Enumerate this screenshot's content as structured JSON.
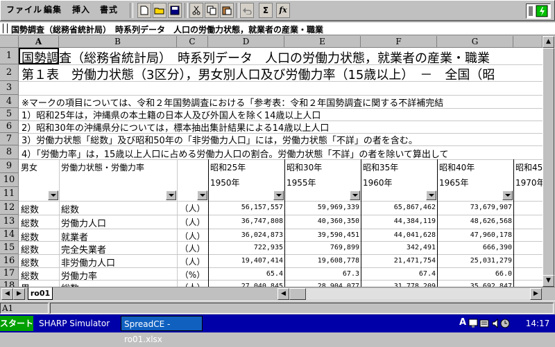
{
  "menu": [
    "ファイル",
    "編集",
    "挿入",
    "書式"
  ],
  "toolbar_icons": [
    "new-file-icon",
    "open-folder-icon",
    "save-icon",
    "cut-icon",
    "copy-icon",
    "paste-icon",
    "undo-icon",
    "sum-icon",
    "function-icon"
  ],
  "toolbar_glyphs": {
    "sum": "Σ",
    "function": "fx"
  },
  "formula_bar": {
    "content": "国勢調査（総務省統計局）　時系列データ　人口の労働力状態，就業者の産業・職業"
  },
  "columns": [
    "A",
    "B",
    "C",
    "D",
    "E",
    "F",
    "G"
  ],
  "rows": [
    "1",
    "2",
    "3",
    "4",
    "5",
    "6",
    "7",
    "8",
    "9",
    "10",
    "11",
    "12",
    "13",
    "14",
    "15",
    "16",
    "17",
    "18"
  ],
  "text_rows": {
    "r1": "国勢調査（総務省統計局）　時系列データ　人口の労働力状態，就業者の産業・職業",
    "r2": "第１表　労働力状態（3区分），男女別人口及び労働力率（15歳以上）　－　全国（昭",
    "r4": "※マークの項目については、令和２年国勢調査における「参考表：令和２年国勢調査に関する不詳補完結",
    "r5": "1）昭和25年は，沖縄県の本土籍の日本人及び外国人を除く14歳以上人口",
    "r6": "2）昭和30年の沖縄県分については，標本抽出集計結果による14歳以上人口",
    "r7": "3）労働力状態「総数」及び昭和50年の「非労働力人口」には，労働力状態「不詳」の者を含む。",
    "r8": "4）「労働力率」は，15歳以上人口に占める労働力人口の割合。労働力状態「不詳」の者を除いて算出して"
  },
  "header": {
    "a9": "男女",
    "b9": "労働力状態・労働力率",
    "years": [
      "昭和25年",
      "昭和30年",
      "昭和35年",
      "昭和40年",
      "昭和45"
    ],
    "western": [
      "1950年",
      "1955年",
      "1960年",
      "1965年",
      "1970年"
    ]
  },
  "data_rows": [
    {
      "a": "総数",
      "b": "総数",
      "c": "（人）",
      "v": [
        "56,157,557",
        "59,969,339",
        "65,867,462",
        "73,679,907"
      ]
    },
    {
      "a": "総数",
      "b": "労働力人口",
      "c": "（人）",
      "v": [
        "36,747,808",
        "40,360,350",
        "44,384,119",
        "48,626,568"
      ]
    },
    {
      "a": "総数",
      "b": "就業者",
      "c": "（人）",
      "v": [
        "36,024,873",
        "39,590,451",
        "44,041,628",
        "47,960,178"
      ]
    },
    {
      "a": "総数",
      "b": "完全失業者",
      "c": "（人）",
      "v": [
        "722,935",
        "769,899",
        "342,491",
        "666,390"
      ]
    },
    {
      "a": "総数",
      "b": "非労働力人口",
      "c": "（人）",
      "v": [
        "19,407,414",
        "19,608,778",
        "21,471,754",
        "25,031,279"
      ]
    },
    {
      "a": "総数",
      "b": "労働力率",
      "c": "（%）",
      "v": [
        "65.4",
        "67.3",
        "67.4",
        "66.0"
      ]
    },
    {
      "a": "男",
      "b": "総数",
      "c": "（人）",
      "v": [
        "27,040,845",
        "28,904,077",
        "31,778,209",
        "35,692,847"
      ]
    }
  ],
  "sheet_tab": "ro01",
  "status_cell": "A1",
  "taskbar": {
    "start": "スタート",
    "items": [
      "SHARP Simulator",
      "SpreadCE - ro01.xlsx"
    ],
    "clock": "14:17",
    "tray_letter": "A"
  }
}
